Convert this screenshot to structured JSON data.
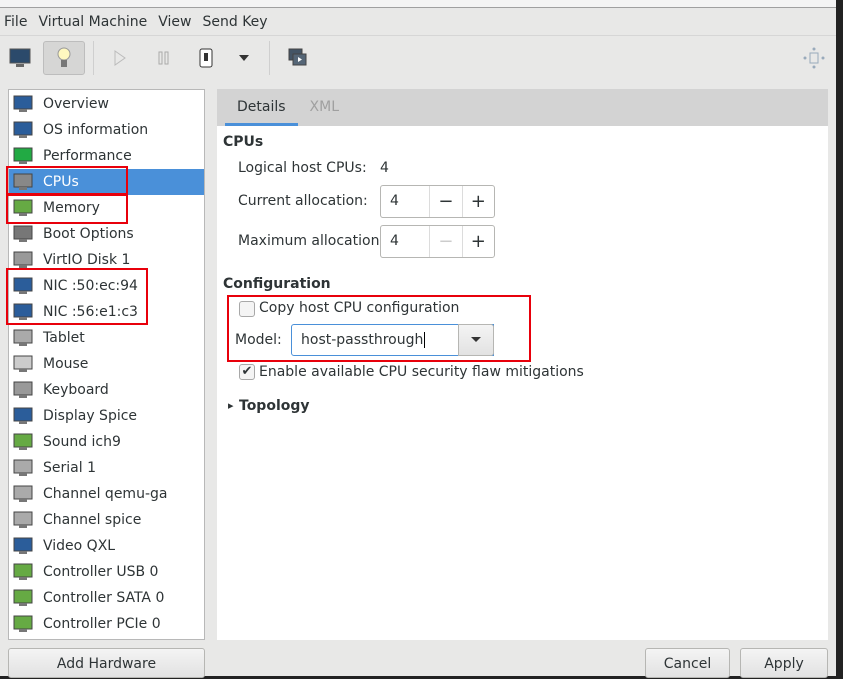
{
  "menu": [
    "File",
    "Virtual Machine",
    "View",
    "Send Key"
  ],
  "toolbar": {
    "icons": [
      "console-monitor-icon",
      "details-lightbulb-icon",
      "run-icon",
      "pause-icon",
      "shutdown-icon",
      "shutdown-menu-icon",
      "snapshots-icon",
      "fullscreen-icon"
    ]
  },
  "sidebar": {
    "items": [
      {
        "label": "Overview",
        "icon": "monitor-icon"
      },
      {
        "label": "OS information",
        "icon": "monitor-icon"
      },
      {
        "label": "Performance",
        "icon": "performance-icon"
      },
      {
        "label": "CPUs",
        "icon": "cpu-icon",
        "selected": true
      },
      {
        "label": "Memory",
        "icon": "memory-icon"
      },
      {
        "label": "Boot Options",
        "icon": "gear-icon"
      },
      {
        "label": "VirtIO Disk 1",
        "icon": "disk-icon"
      },
      {
        "label": "NIC :50:ec:94",
        "icon": "network-icon"
      },
      {
        "label": "NIC :56:e1:c3",
        "icon": "network-icon"
      },
      {
        "label": "Tablet",
        "icon": "tablet-icon"
      },
      {
        "label": "Mouse",
        "icon": "mouse-icon"
      },
      {
        "label": "Keyboard",
        "icon": "keyboard-icon"
      },
      {
        "label": "Display Spice",
        "icon": "display-icon"
      },
      {
        "label": "Sound ich9",
        "icon": "sound-icon"
      },
      {
        "label": "Serial 1",
        "icon": "serial-icon"
      },
      {
        "label": "Channel qemu-ga",
        "icon": "channel-icon"
      },
      {
        "label": "Channel spice",
        "icon": "channel-icon"
      },
      {
        "label": "Video QXL",
        "icon": "video-icon"
      },
      {
        "label": "Controller USB 0",
        "icon": "controller-icon"
      },
      {
        "label": "Controller SATA 0",
        "icon": "controller-icon"
      },
      {
        "label": "Controller PCIe 0",
        "icon": "controller-icon"
      }
    ]
  },
  "tabs": [
    "Details",
    "XML"
  ],
  "cpus": {
    "heading": "CPUs",
    "logical_label": "Logical host CPUs:",
    "logical_value": "4",
    "current_label": "Current allocation:",
    "current_value": "4",
    "max_label": "Maximum allocation:",
    "max_value": "4",
    "minus": "−",
    "plus": "+"
  },
  "config": {
    "heading": "Configuration",
    "copy_label": "Copy host CPU configuration",
    "copy_checked": false,
    "model_label": "Model:",
    "model_value": "host-passthrough",
    "mitigation_label": "Enable available CPU security flaw mitigations",
    "mitigation_checked": true,
    "check_mark": "✔"
  },
  "topology": {
    "label": "Topology",
    "arrow": "▸"
  },
  "buttons": {
    "add": "Add Hardware",
    "cancel": "Cancel",
    "apply": "Apply"
  },
  "colors": {
    "accent": "#4a90d9",
    "highlight": "#e8000b"
  }
}
